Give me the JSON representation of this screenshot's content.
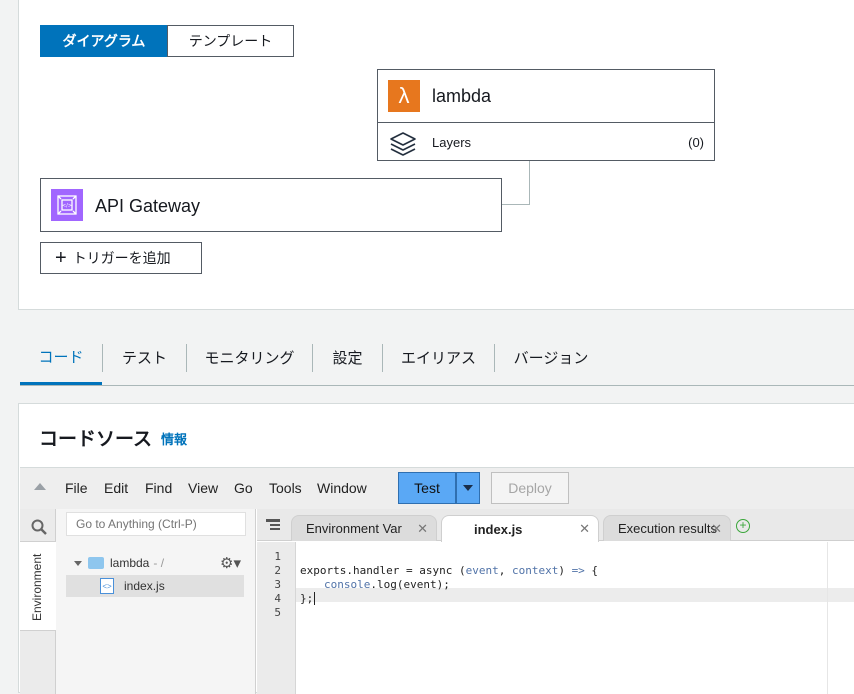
{
  "diagram": {
    "segmented": {
      "diagram_label": "ダイアグラム",
      "template_label": "テンプレート"
    },
    "lambda": {
      "name": "lambda",
      "layers_label": "Layers",
      "layers_count": "(0)"
    },
    "trigger": {
      "name": "API Gateway"
    },
    "add_trigger_label": "トリガーを追加"
  },
  "tabs": [
    {
      "label": "コード",
      "active": true
    },
    {
      "label": "テスト"
    },
    {
      "label": "モニタリング"
    },
    {
      "label": "設定"
    },
    {
      "label": "エイリアス"
    },
    {
      "label": "バージョン"
    }
  ],
  "code_source": {
    "title": "コードソース",
    "info_link": "情報",
    "menu": [
      "File",
      "Edit",
      "Find",
      "View",
      "Go",
      "Tools",
      "Window"
    ],
    "test_label": "Test",
    "deploy_label": "Deploy",
    "goto_placeholder": "Go to Anything (Ctrl-P)",
    "env_label": "Environment",
    "tree": {
      "folder": "lambda",
      "folder_path": "- /",
      "file": "index.js"
    },
    "editor_tabs": [
      {
        "label": "Environment Var"
      },
      {
        "label": "index.js",
        "active": true
      },
      {
        "label": "Execution results"
      }
    ],
    "line_numbers": [
      "1",
      "2",
      "3",
      "4",
      "5"
    ],
    "code": {
      "l2_a": "exports.handler = async (",
      "l2_event": "event",
      "l2_b": ", ",
      "l2_context": "context",
      "l2_c": ") ",
      "l2_arrow": "=>",
      "l2_d": " {",
      "l3_console": "console",
      "l3_b": ".log(event);",
      "l4": "};"
    }
  },
  "colors": {
    "accent": "#0073bb",
    "lambda_orange": "#e7771e",
    "apigw_purple": "#a166ff",
    "test_button": "#5aa8f5"
  }
}
